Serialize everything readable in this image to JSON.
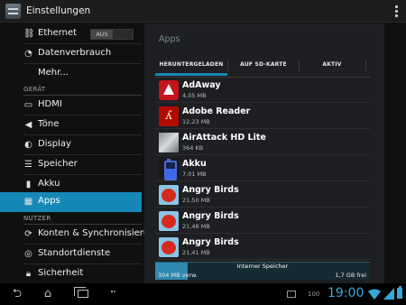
{
  "actionbar": {
    "title": "Einstellungen",
    "icon": "settings-app-icon"
  },
  "sidebar": {
    "items": [
      {
        "label": "Ethernet",
        "icon": "ethernet-icon",
        "toggle": "AUS"
      },
      {
        "label": "Datenverbrauch",
        "icon": "data-usage-icon"
      },
      {
        "label": "Mehr...",
        "icon": ""
      }
    ],
    "device_header": "GERÄT",
    "device_items": [
      {
        "label": "HDMI",
        "icon": "monitor-icon"
      },
      {
        "label": "Töne",
        "icon": "speaker-icon"
      },
      {
        "label": "Display",
        "icon": "brightness-icon"
      },
      {
        "label": "Speicher",
        "icon": "storage-icon"
      },
      {
        "label": "Akku",
        "icon": "battery-icon"
      },
      {
        "label": "Apps",
        "icon": "apps-icon",
        "selected": true
      }
    ],
    "user_header": "NUTZER",
    "user_items": [
      {
        "label": "Konten & Synchronisieru..",
        "icon": "sync-icon"
      },
      {
        "label": "Standortdienste",
        "icon": "location-icon"
      },
      {
        "label": "Sicherheit",
        "icon": "lock-icon"
      }
    ]
  },
  "apps_pane": {
    "title": "Apps",
    "tabs": [
      "HERUNTERGELADEN",
      "AUF SD-KARTE",
      "AKTIV"
    ],
    "active_tab": 0,
    "apps": [
      {
        "name": "AdAway",
        "size": "4,05 MB",
        "icon": "adaway-icon"
      },
      {
        "name": "Adobe Reader",
        "size": "12,23 MB",
        "icon": "adobe-reader-icon"
      },
      {
        "name": "AirAttack HD Lite",
        "size": "364 KB",
        "icon": "airattack-icon"
      },
      {
        "name": "Akku",
        "size": "7,01 MB",
        "icon": "akku-battery-icon"
      },
      {
        "name": "Angry Birds",
        "size": "21,50 MB",
        "icon": "angry-birds-icon"
      },
      {
        "name": "Angry Birds",
        "size": "21,48 MB",
        "icon": "angry-birds-icon"
      },
      {
        "name": "Angry Birds",
        "size": "21,41 MB",
        "icon": "angry-birds-icon"
      }
    ],
    "storage": {
      "title": "Interner Speicher",
      "used": "304 MB verw.",
      "free": "1,7 GB frei",
      "used_fraction": 0.15
    }
  },
  "statusbar": {
    "time": "19:00",
    "battery_level": "100"
  },
  "colors": {
    "accent": "#1688b8",
    "clock": "#35a9d9"
  }
}
